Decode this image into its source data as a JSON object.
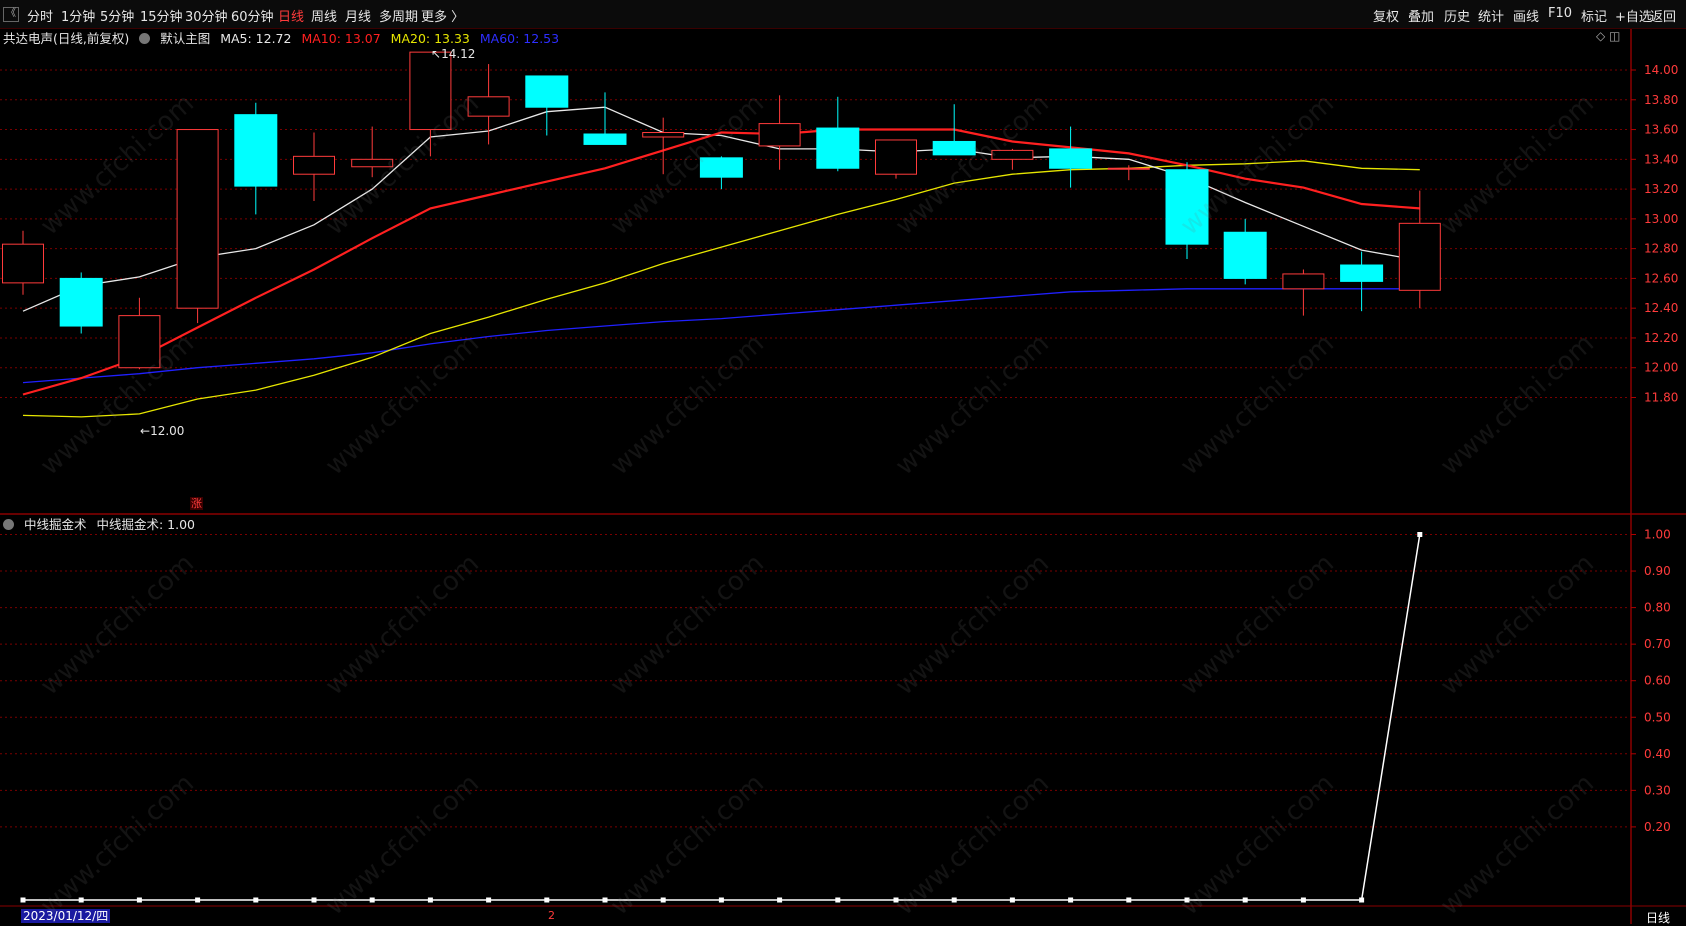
{
  "toolbar": {
    "collapse_icon": "《",
    "left_items": [
      "分时",
      "1分钟",
      "5分钟",
      "15分钟",
      "30分钟",
      "60分钟",
      "日线",
      "周线",
      "月线",
      "多周期",
      "更多 〉"
    ],
    "active_item": "日线",
    "right_items": [
      "复权",
      "叠加",
      "历史",
      "统计",
      "画线",
      "F10",
      "标记",
      "+自选",
      "返回"
    ]
  },
  "main_legend": {
    "title": "共达电声(日线,前复权)",
    "main_chart_label": "默认主图",
    "ma5": "MA5: 12.72",
    "ma10": "MA10: 13.07",
    "ma20": "MA20: 13.33",
    "ma60": "MA60: 12.53"
  },
  "main_annotations": {
    "high": "14.12",
    "low": "12.00",
    "marker": "涨"
  },
  "indicator_legend": {
    "title": "中线掘金术",
    "value_label": "中线掘金术: 1.00"
  },
  "footer": {
    "date": "2023/01/12/四",
    "mark": "2",
    "period": "日线"
  },
  "top_right_icons": "◇ ◫",
  "colors": {
    "up": "#ff3b3b",
    "down": "#00ffff",
    "ma5": "#e8e8e8",
    "ma10": "#ff2020",
    "ma20": "#e6e600",
    "ma60": "#2020ff",
    "indicator": "#ffffff",
    "grid": "#7a0000"
  },
  "watermark_text": "www.cfchi.com",
  "chart_data": [
    {
      "type": "candlestick",
      "y_ticks": [
        "14.00",
        "13.80",
        "13.60",
        "13.40",
        "13.20",
        "13.00",
        "12.80",
        "12.60",
        "12.40",
        "12.20",
        "12.00",
        "11.80"
      ],
      "ylim": [
        11.62,
        14.12
      ],
      "candles": [
        {
          "o": 12.57,
          "c": 12.83,
          "h": 12.92,
          "l": 12.49
        },
        {
          "o": 12.6,
          "c": 12.28,
          "h": 12.64,
          "l": 12.23
        },
        {
          "o": 12.0,
          "c": 12.35,
          "h": 12.47,
          "l": 11.99
        },
        {
          "o": 12.4,
          "c": 13.6,
          "h": 13.6,
          "l": 12.3
        },
        {
          "o": 13.7,
          "c": 13.22,
          "h": 13.78,
          "l": 13.03
        },
        {
          "o": 13.3,
          "c": 13.42,
          "h": 13.58,
          "l": 13.12
        },
        {
          "o": 13.35,
          "c": 13.4,
          "h": 13.62,
          "l": 13.28
        },
        {
          "o": 13.6,
          "c": 14.12,
          "h": 14.12,
          "l": 13.42
        },
        {
          "o": 13.69,
          "c": 13.82,
          "h": 14.04,
          "l": 13.5
        },
        {
          "o": 13.96,
          "c": 13.75,
          "h": 13.96,
          "l": 13.56
        },
        {
          "o": 13.57,
          "c": 13.5,
          "h": 13.85,
          "l": 13.5
        },
        {
          "o": 13.55,
          "c": 13.58,
          "h": 13.68,
          "l": 13.3
        },
        {
          "o": 13.41,
          "c": 13.28,
          "h": 13.42,
          "l": 13.2
        },
        {
          "o": 13.49,
          "c": 13.64,
          "h": 13.83,
          "l": 13.33
        },
        {
          "o": 13.61,
          "c": 13.34,
          "h": 13.82,
          "l": 13.32
        },
        {
          "o": 13.3,
          "c": 13.53,
          "h": 13.53,
          "l": 13.27
        },
        {
          "o": 13.52,
          "c": 13.43,
          "h": 13.77,
          "l": 13.43
        },
        {
          "o": 13.4,
          "c": 13.46,
          "h": 13.47,
          "l": 13.33
        },
        {
          "o": 13.47,
          "c": 13.34,
          "h": 13.62,
          "l": 13.21
        },
        {
          "o": 13.34,
          "c": 13.34,
          "h": 13.36,
          "l": 13.26
        },
        {
          "o": 13.33,
          "c": 12.83,
          "h": 13.38,
          "l": 12.73
        },
        {
          "o": 12.91,
          "c": 12.6,
          "h": 13.0,
          "l": 12.56
        },
        {
          "o": 12.53,
          "c": 12.63,
          "h": 12.66,
          "l": 12.35
        },
        {
          "o": 12.69,
          "c": 12.58,
          "h": 12.78,
          "l": 12.38
        },
        {
          "o": 12.52,
          "c": 12.97,
          "h": 13.19,
          "l": 12.4
        }
      ],
      "ma5": [
        12.38,
        12.55,
        12.61,
        12.74,
        12.8,
        12.96,
        13.2,
        13.55,
        13.59,
        13.72,
        13.75,
        13.58,
        13.56,
        13.47,
        13.47,
        13.45,
        13.47,
        13.41,
        13.42,
        13.4,
        13.28,
        13.11,
        12.95,
        12.79,
        12.72
      ],
      "ma10": [
        11.82,
        11.93,
        12.07,
        12.27,
        12.47,
        12.66,
        12.87,
        13.07,
        13.16,
        13.25,
        13.34,
        13.46,
        13.58,
        13.57,
        13.6,
        13.6,
        13.6,
        13.52,
        13.48,
        13.44,
        13.36,
        13.27,
        13.21,
        13.1,
        13.07
      ],
      "ma20": [
        11.68,
        11.67,
        11.69,
        11.79,
        11.85,
        11.95,
        12.07,
        12.23,
        12.34,
        12.46,
        12.57,
        12.7,
        12.81,
        12.92,
        13.03,
        13.13,
        13.24,
        13.3,
        13.33,
        13.34,
        13.36,
        13.37,
        13.39,
        13.34,
        13.33
      ],
      "ma60": [
        11.9,
        11.93,
        11.96,
        12.0,
        12.03,
        12.06,
        12.1,
        12.16,
        12.21,
        12.25,
        12.28,
        12.31,
        12.33,
        12.36,
        12.39,
        12.42,
        12.45,
        12.48,
        12.51,
        12.52,
        12.53,
        12.53,
        12.53,
        12.53,
        12.53
      ]
    },
    {
      "type": "line",
      "name": "中线掘金术",
      "y_ticks": [
        "1.00",
        "0.90",
        "0.80",
        "0.70",
        "0.60",
        "0.50",
        "0.40",
        "0.30",
        "0.20"
      ],
      "ylim": [
        0.0,
        1.0
      ],
      "values": [
        0,
        0,
        0,
        0,
        0,
        0,
        0,
        0,
        0,
        0,
        0,
        0,
        0,
        0,
        0,
        0,
        0,
        0,
        0,
        0,
        0,
        0,
        0,
        0,
        1.0
      ]
    }
  ]
}
